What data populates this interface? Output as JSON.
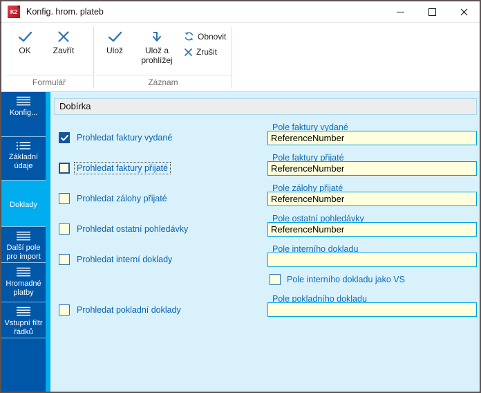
{
  "window": {
    "title": "Konfig. hrom. plateb",
    "app_icon_text": "K2",
    "controls": {
      "minimize_icon": "minimize-icon",
      "maximize_icon": "maximize-icon",
      "close_icon": "close-icon"
    }
  },
  "ribbon": {
    "groups": [
      {
        "label": "Formulář",
        "buttons": [
          {
            "label": "OK",
            "icon": "check-icon"
          },
          {
            "label": "Zavřít",
            "icon": "close-icon"
          }
        ]
      },
      {
        "label": "Záznam",
        "buttons": [
          {
            "label": "Ulož",
            "icon": "check-icon"
          },
          {
            "label": "Ulož a prohlížej",
            "icon": "save-browse-icon"
          }
        ],
        "small_buttons": [
          {
            "label": "Obnovit",
            "icon": "refresh-icon"
          },
          {
            "label": "Zrušit",
            "icon": "close-icon"
          }
        ]
      }
    ]
  },
  "sidebar": {
    "items": [
      {
        "label": "Konfig...",
        "selected": false
      },
      {
        "label": "Základní údaje",
        "selected": false
      },
      {
        "label": "Doklady",
        "selected": true
      },
      {
        "label": "Další pole pro import",
        "selected": false
      },
      {
        "label": "Hromadné platby",
        "selected": false
      },
      {
        "label": "Vstupní filtr řádků",
        "selected": false
      }
    ]
  },
  "content": {
    "section_title": "Dobírka",
    "checkboxes": [
      {
        "label": "Prohledat faktury vydané",
        "checked": true,
        "focused": false
      },
      {
        "label": "Prohledat faktury přijaté",
        "checked": false,
        "focused": true
      },
      {
        "label": "Prohledat zálohy přijaté",
        "checked": false,
        "focused": false
      },
      {
        "label": "Prohledat ostatní pohledávky",
        "checked": false,
        "focused": false
      },
      {
        "label": "Prohledat interní doklady",
        "checked": false,
        "focused": false
      },
      {
        "label": "Prohledat pokladní doklady",
        "checked": false,
        "focused": false
      }
    ],
    "fields": [
      {
        "label": "Pole faktury vydané",
        "value": "ReferenceNumber"
      },
      {
        "label": "Pole faktury přijaté",
        "value": "ReferenceNumber"
      },
      {
        "label": "Pole zálohy přijaté",
        "value": "ReferenceNumber"
      },
      {
        "label": "Pole ostatní pohledávky",
        "value": "ReferenceNumber"
      },
      {
        "label": "Pole interního dokladu",
        "value": ""
      },
      {
        "label": "Pole pokladního dokladu",
        "value": ""
      }
    ],
    "vs_checkbox": {
      "label": "Pole interního dokladu jako VS",
      "checked": false
    }
  },
  "colors": {
    "sidebar_blue": "#0057A7",
    "selected_tab_cyan": "#00ADEF",
    "content_background": "#D9F1FB",
    "input_background": "#FFFFDE",
    "input_border": "#00A3E5",
    "label_blue": "#0F6CB6",
    "checkbox_checked_blue": "#15549C",
    "ribbon_icon_blue": "#2E74B5",
    "app_icon_red": "#C4182B"
  }
}
